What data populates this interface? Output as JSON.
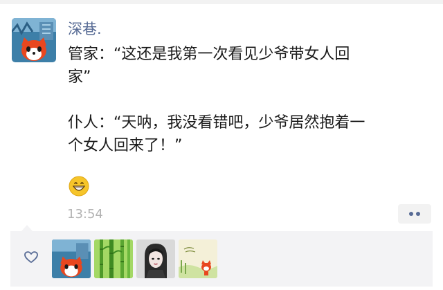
{
  "post": {
    "username": "深巷.",
    "lines": [
      "管家：“这还是我第一次看见少爷带女人回",
      "家”",
      "仆人：“天呐，我没看错吧，少爷居然抱着一",
      "个女人回来了！”"
    ],
    "emoji": "grinning-face",
    "time": "13:54"
  },
  "likes": {
    "icon": "heart-outline-icon",
    "avatars": [
      "fox-cartoon-avatar",
      "bamboo-avatar",
      "girl-portrait-avatar",
      "illustration-avatar"
    ]
  },
  "colors": {
    "username": "#576b95",
    "text": "#1a1a1a",
    "time": "#b2b2b2",
    "likes_bg": "#f3f3f5"
  }
}
